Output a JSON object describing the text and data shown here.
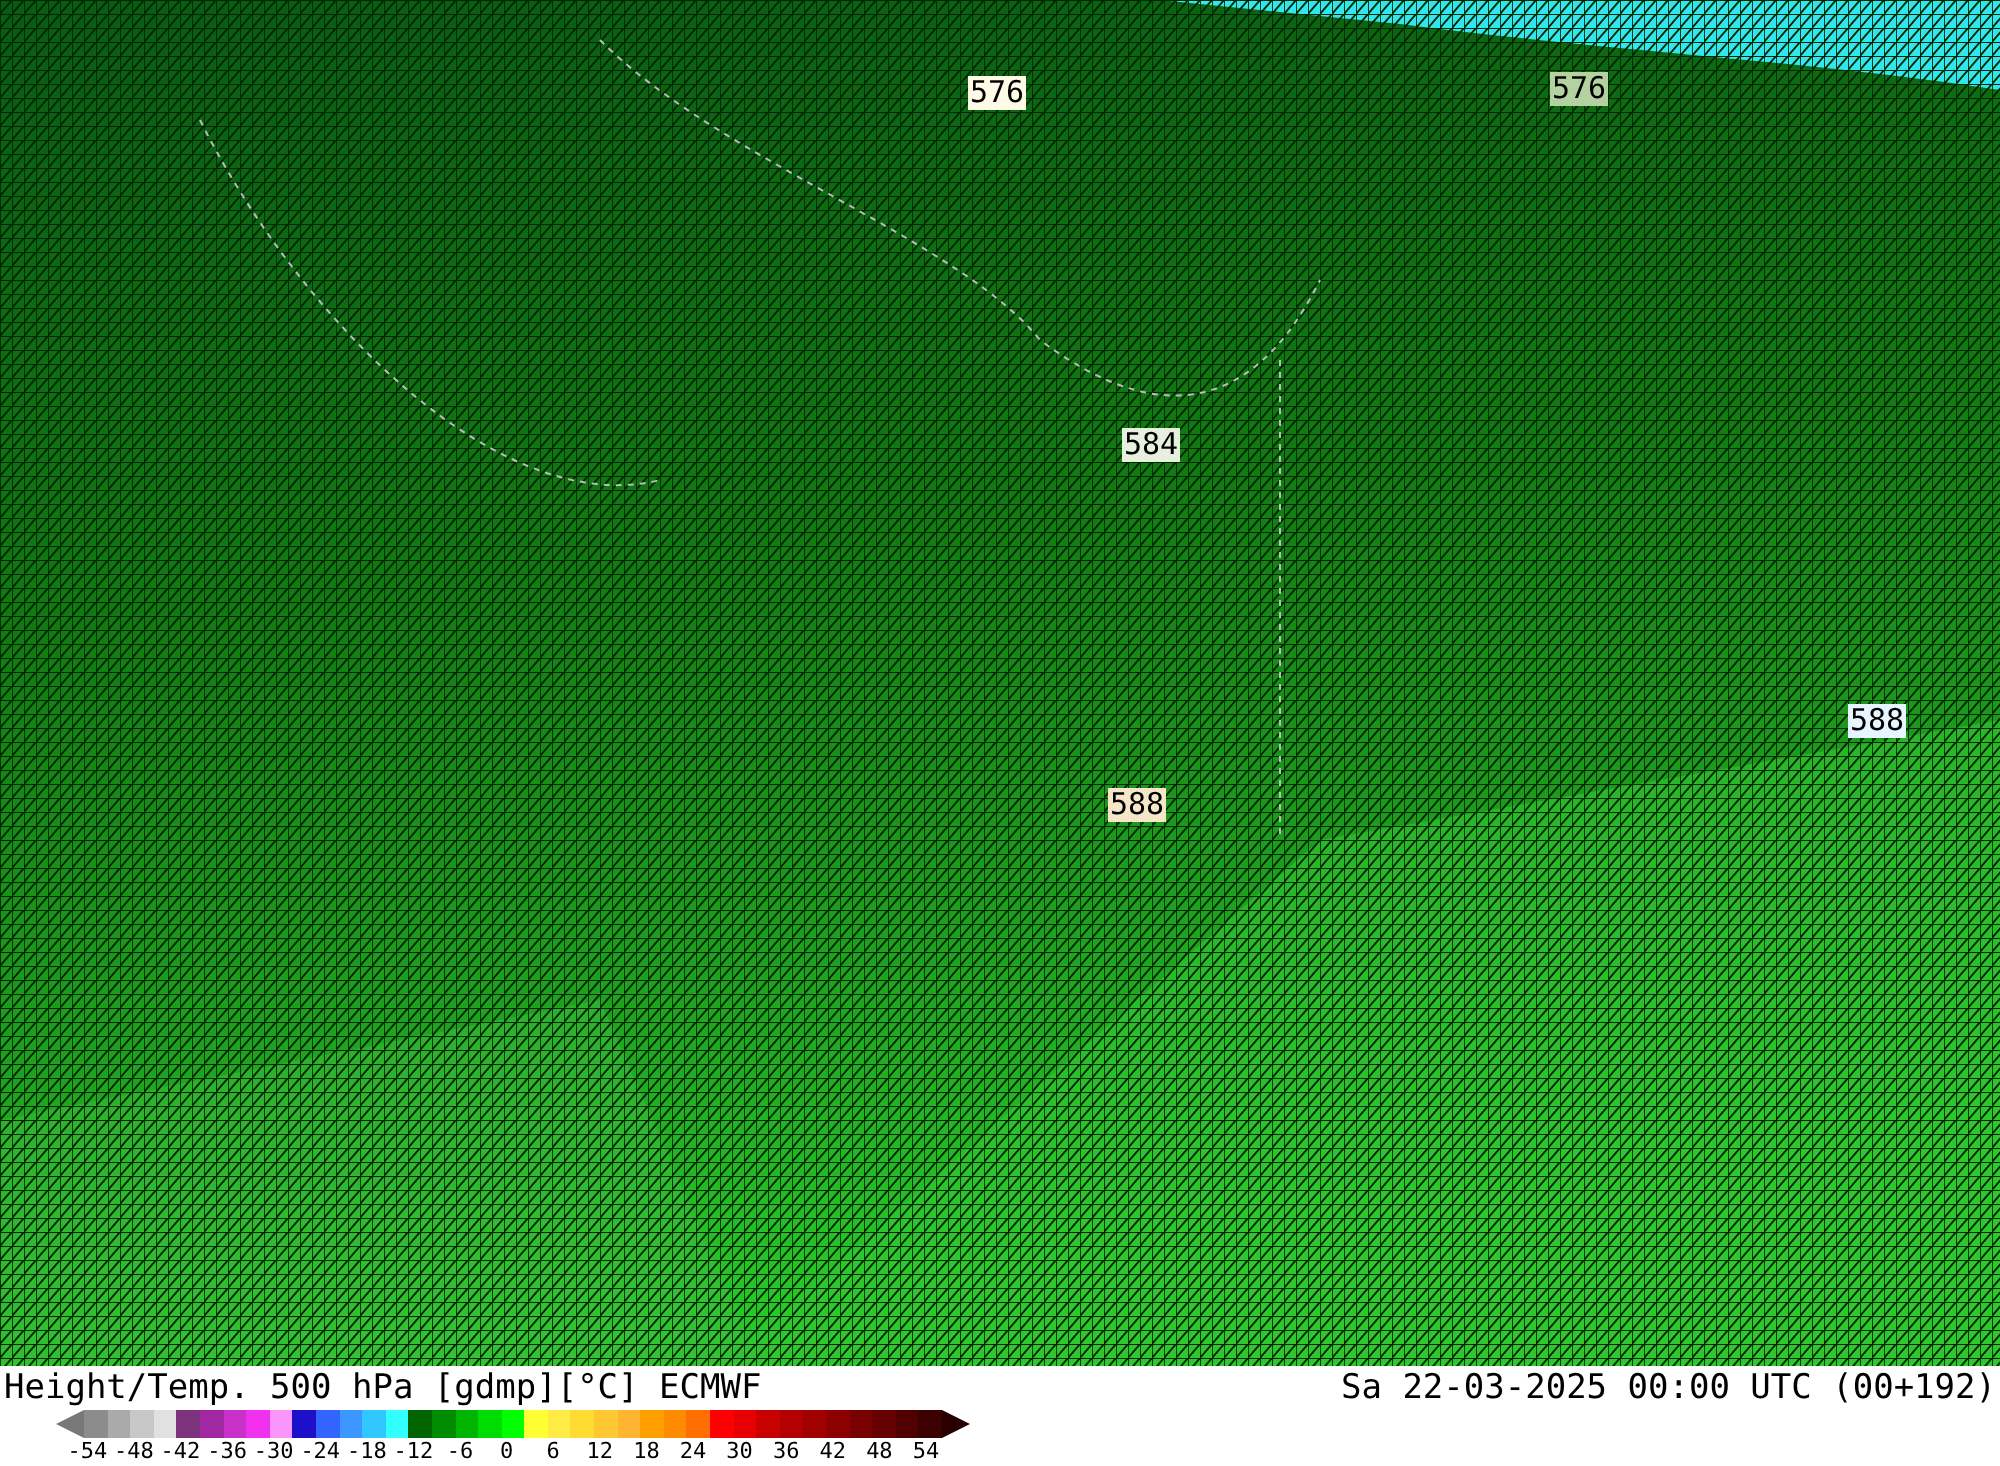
{
  "map": {
    "contour_labels": [
      {
        "text": "576",
        "color": "#fffbe6"
      },
      {
        "text": "576",
        "color": "#b4d2a0"
      },
      {
        "text": "584",
        "color": "#e6f0dc"
      },
      {
        "text": "588",
        "color": "#e6f5ff"
      },
      {
        "text": "588",
        "color": "#f5e6c8"
      }
    ]
  },
  "footer": {
    "title": "Height/Temp. 500 hPa [gdmp][°C] ECMWF",
    "valid_time": "Sa 22-03-2025 00:00 UTC (00+192)"
  },
  "colorbar": {
    "swatches": [
      {
        "color": "#8c8c8c"
      },
      {
        "color": "#aaaaaa"
      },
      {
        "color": "#c8c8c8"
      },
      {
        "color": "#e1e1e1"
      },
      {
        "color": "#7d327d"
      },
      {
        "color": "#a028a0"
      },
      {
        "color": "#c832c8"
      },
      {
        "color": "#f032f0"
      },
      {
        "color": "#fa96fa"
      },
      {
        "color": "#1e0fc8"
      },
      {
        "color": "#3264ff"
      },
      {
        "color": "#3c96ff"
      },
      {
        "color": "#32c8ff"
      },
      {
        "color": "#32ffff"
      },
      {
        "color": "#006400"
      },
      {
        "color": "#008c00"
      },
      {
        "color": "#00b400"
      },
      {
        "color": "#00dc00"
      },
      {
        "color": "#00ff00"
      },
      {
        "color": "#ffff32"
      },
      {
        "color": "#ffeb46"
      },
      {
        "color": "#ffdc32"
      },
      {
        "color": "#ffc832"
      },
      {
        "color": "#ffb432"
      },
      {
        "color": "#ffa000"
      },
      {
        "color": "#ff8c00"
      },
      {
        "color": "#ff6e00"
      },
      {
        "color": "#ff0000"
      },
      {
        "color": "#e60000"
      },
      {
        "color": "#c80000"
      },
      {
        "color": "#b40000"
      },
      {
        "color": "#a00000"
      },
      {
        "color": "#8c0000"
      },
      {
        "color": "#780000"
      },
      {
        "color": "#640000"
      },
      {
        "color": "#500000"
      },
      {
        "color": "#3c0000"
      }
    ],
    "ticks": [
      "-54",
      "-48",
      "-42",
      "-36",
      "-30",
      "-24",
      "-18",
      "-12",
      "-6",
      "0",
      "6",
      "12",
      "18",
      "24",
      "30",
      "36",
      "42",
      "48",
      "54"
    ]
  }
}
